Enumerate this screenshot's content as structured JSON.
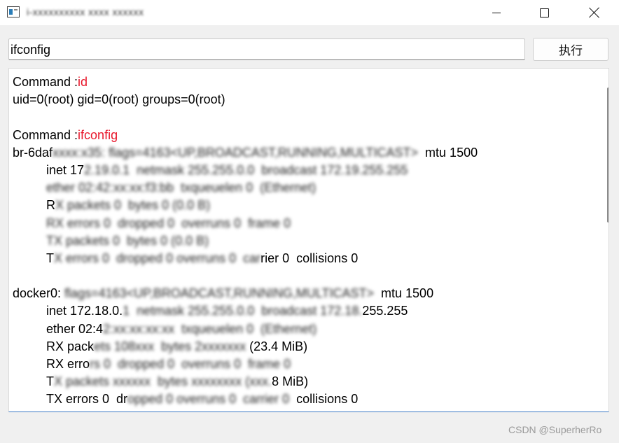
{
  "window": {
    "title": "i-xxxxxxxxxx xxxx xxxxxx",
    "controls": {
      "minimize": "minimize",
      "maximize": "maximize",
      "close": "close"
    }
  },
  "toolbar": {
    "command_value": "ifconfig",
    "exec_label": "执行"
  },
  "output": {
    "blocks": [
      {
        "prefix": "Command :",
        "command": "id",
        "lines": [
          {
            "indent": false,
            "visible": "uid=0(root) gid=0(root) groups=0(root)",
            "obscured": ""
          }
        ]
      },
      {
        "prefix": "Command :",
        "command": "ifconfig",
        "lines": [
          {
            "indent": false,
            "visible": "br-6daf",
            "obscured": "xxxx:x35: flags=4163<UP,BROADCAST,RUNNING,MULTICAST>",
            "visible2": "  mtu 1500"
          },
          {
            "indent": true,
            "visible": "inet 17",
            "obscured": "2.19.0.1  netmask 255.255.0.0  broadcast 172.19.255.255",
            "visible2": ""
          },
          {
            "indent": true,
            "visible": "",
            "obscured": "ether 02:42:xx:xx:f3:bb  txqueuelen 0  (Ethernet)",
            "visible2": ""
          },
          {
            "indent": true,
            "visible": "R",
            "obscured": "X packets 0  bytes 0 (0.0 B)",
            "visible2": ""
          },
          {
            "indent": true,
            "visible": "",
            "obscured": "RX errors 0  dropped 0  overruns 0  frame 0",
            "visible2": ""
          },
          {
            "indent": true,
            "visible": "",
            "obscured": "TX packets 0  bytes 0 (0.0 B)",
            "visible2": ""
          },
          {
            "indent": true,
            "visible": "T",
            "obscured": "X errors 0  dropped 0 overruns 0  car",
            "visible2": "rier 0  collisions 0"
          }
        ]
      },
      {
        "prefix": "",
        "command": "",
        "lines": [
          {
            "indent": false,
            "visible": "docker0: ",
            "obscured": "flags=4163<UP,BROADCAST,RUNNING,MULTICAST>",
            "visible2": "  mtu 1500"
          },
          {
            "indent": true,
            "visible": "inet 172.18.0.",
            "obscured": "1  netmask 255.255.0.0  broadcast 172.18.",
            "visible2": "255.255"
          },
          {
            "indent": true,
            "visible": "ether 02:4",
            "obscured": "2:xx:xx:xx:xx  txqueuelen 0  (Ethernet)",
            "visible2": ""
          },
          {
            "indent": true,
            "visible": "RX pack",
            "obscured": "ets 108xxx  bytes 2xxxxxxx",
            "visible2": " (23.4 MiB)"
          },
          {
            "indent": true,
            "visible": "RX erro",
            "obscured": "rs 0  dropped 0  overruns 0  frame 0",
            "visible2": ""
          },
          {
            "indent": true,
            "visible": "T",
            "obscured": "X packets xxxxxx  bytes xxxxxxxx (xxx.",
            "visible2": "8 MiB)"
          },
          {
            "indent": true,
            "visible": "TX errors 0  dr",
            "obscured": "opped 0 overruns 0  carrier 0",
            "visible2": "  collisions 0"
          }
        ]
      }
    ]
  },
  "watermark": "CSDN @SuperherRo"
}
